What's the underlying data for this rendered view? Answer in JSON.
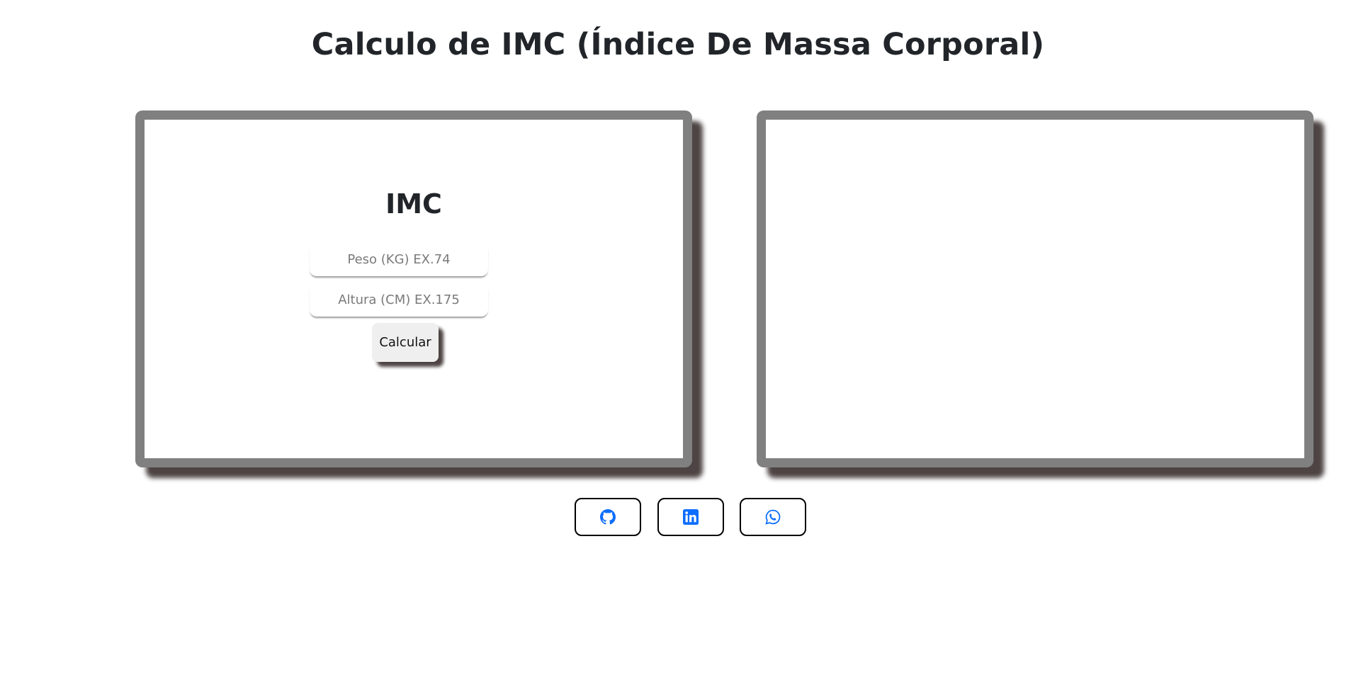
{
  "page": {
    "title": "Calculo de IMC (Índice De Massa Corporal)"
  },
  "form": {
    "heading": "IMC",
    "peso_placeholder": "Peso (KG) EX.74",
    "peso_value": "",
    "altura_placeholder": "Altura (CM) EX.175",
    "altura_value": "",
    "calculate_label": "Calcular"
  },
  "result": {
    "text": ""
  },
  "social": {
    "icons": [
      "github-icon",
      "linkedin-icon",
      "whatsapp-icon"
    ],
    "icon_color": "#0d6efd"
  },
  "colors": {
    "card_border": "#808080",
    "card_shadow": "#4e4444",
    "text": "#212529"
  }
}
